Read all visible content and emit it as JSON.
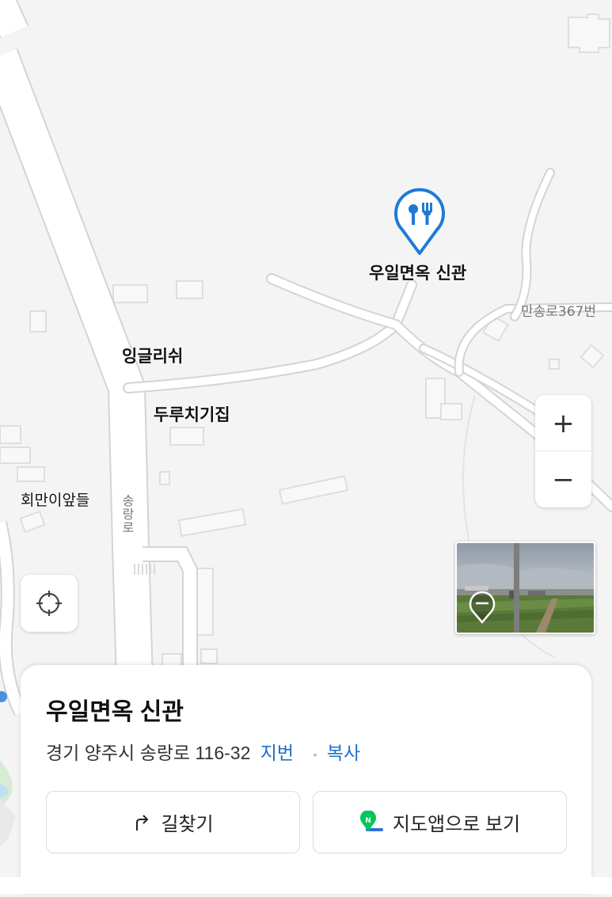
{
  "map": {
    "labels": {
      "restaurant": "우일면옥 신관",
      "english_school": "잉글리쉬",
      "durchi": "두루치기집",
      "hoe": "회만이앞들",
      "road_songrang": "송랑로",
      "road_mansong": "만송로367번"
    },
    "marker_icon": "restaurant-pin-icon",
    "colors": {
      "accent": "#1f7ad6",
      "road": "#ffffff",
      "road_edge": "#d9d9d9",
      "land": "#f4f4f4"
    }
  },
  "controls": {
    "zoom_in": "+",
    "zoom_out": "−",
    "locate_icon": "crosshair-icon",
    "roadview_icon": "roadview-pin-icon"
  },
  "card": {
    "title": "우일면옥 신관",
    "address": "경기 양주시 송랑로 116-32",
    "jibun_link": "지번",
    "copy_link": "복사",
    "dot": "•",
    "directions_label": "길찾기",
    "directions_icon": "turn-arrow-icon",
    "mapapp_label": "지도앱으로 보기",
    "mapapp_icon": "naver-map-icon"
  }
}
